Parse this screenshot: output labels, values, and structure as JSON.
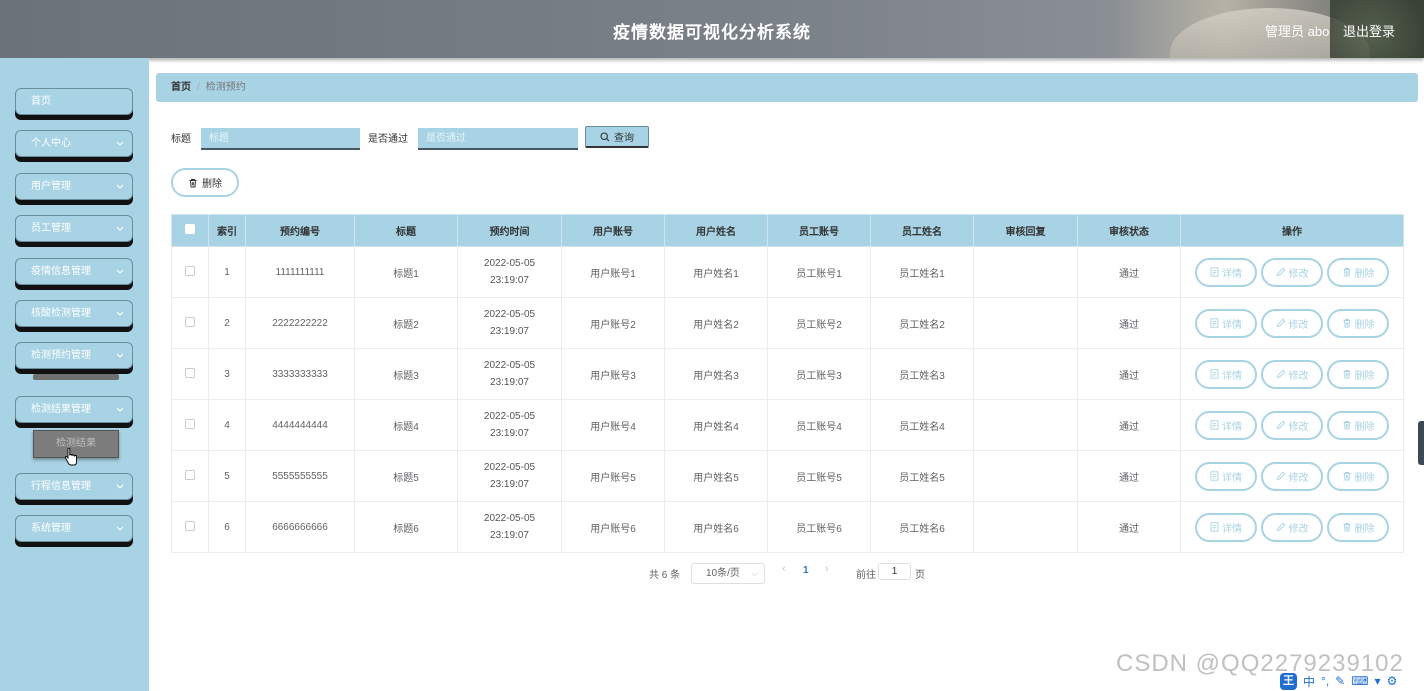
{
  "header": {
    "title": "疫情数据可视化分析系统",
    "user": "管理员 abo",
    "logout": "退出登录"
  },
  "sidebar": {
    "items": [
      {
        "label": "首页"
      },
      {
        "label": "个人中心"
      },
      {
        "label": "用户管理"
      },
      {
        "label": "员工管理"
      },
      {
        "label": "疫情信息管理"
      },
      {
        "label": "核酸检测管理"
      },
      {
        "label": "检测预约管理"
      },
      {
        "label": "检测结果管理"
      },
      {
        "label": "行程信息管理"
      },
      {
        "label": "系统管理"
      }
    ],
    "sub_item": "检测结果"
  },
  "breadcrumb": {
    "home": "首页",
    "current": "检测预约"
  },
  "search": {
    "title_label": "标题",
    "title_placeholder": "标题",
    "pass_label": "是否通过",
    "pass_placeholder": "是否通过",
    "query_button": "查询"
  },
  "delete_button": "删除",
  "table": {
    "headers": [
      "索引",
      "预约编号",
      "标题",
      "预约时间",
      "用户账号",
      "用户姓名",
      "员工账号",
      "员工姓名",
      "审核回复",
      "审核状态",
      "操作"
    ],
    "rows": [
      {
        "index": "1",
        "code": "1111111111",
        "title": "标题1",
        "time": "2022-05-05 23:19:07",
        "user_account": "用户账号1",
        "user_name": "用户姓名1",
        "staff_account": "员工账号1",
        "staff_name": "员工姓名1",
        "reply": "",
        "status": "通过"
      },
      {
        "index": "2",
        "code": "2222222222",
        "title": "标题2",
        "time": "2022-05-05 23:19:07",
        "user_account": "用户账号2",
        "user_name": "用户姓名2",
        "staff_account": "员工账号2",
        "staff_name": "员工姓名2",
        "reply": "",
        "status": "通过"
      },
      {
        "index": "3",
        "code": "3333333333",
        "title": "标题3",
        "time": "2022-05-05 23:19:07",
        "user_account": "用户账号3",
        "user_name": "用户姓名3",
        "staff_account": "员工账号3",
        "staff_name": "员工姓名3",
        "reply": "",
        "status": "通过"
      },
      {
        "index": "4",
        "code": "4444444444",
        "title": "标题4",
        "time": "2022-05-05 23:19:07",
        "user_account": "用户账号4",
        "user_name": "用户姓名4",
        "staff_account": "员工账号4",
        "staff_name": "员工姓名4",
        "reply": "",
        "status": "通过"
      },
      {
        "index": "5",
        "code": "5555555555",
        "title": "标题5",
        "time": "2022-05-05 23:19:07",
        "user_account": "用户账号5",
        "user_name": "用户姓名5",
        "staff_account": "员工账号5",
        "staff_name": "员工姓名5",
        "reply": "",
        "status": "通过"
      },
      {
        "index": "6",
        "code": "6666666666",
        "title": "标题6",
        "time": "2022-05-05 23:19:07",
        "user_account": "用户账号6",
        "user_name": "用户姓名6",
        "staff_account": "员工账号6",
        "staff_name": "员工姓名6",
        "reply": "",
        "status": "通过"
      }
    ],
    "actions": {
      "detail": "详情",
      "edit": "修改",
      "delete": "删除"
    }
  },
  "pagination": {
    "total": "共 6 条",
    "page_size": "10条/页",
    "current_page": "1",
    "goto_label": "前往",
    "goto_value": "1",
    "page_unit": "页"
  },
  "watermark": "CSDN @QQ2279239102",
  "ime": {
    "logo": "王",
    "mode": "中"
  },
  "colors": {
    "accent": "#a8d3e4",
    "header": "#747a82",
    "active_page": "#2b7bb9"
  }
}
